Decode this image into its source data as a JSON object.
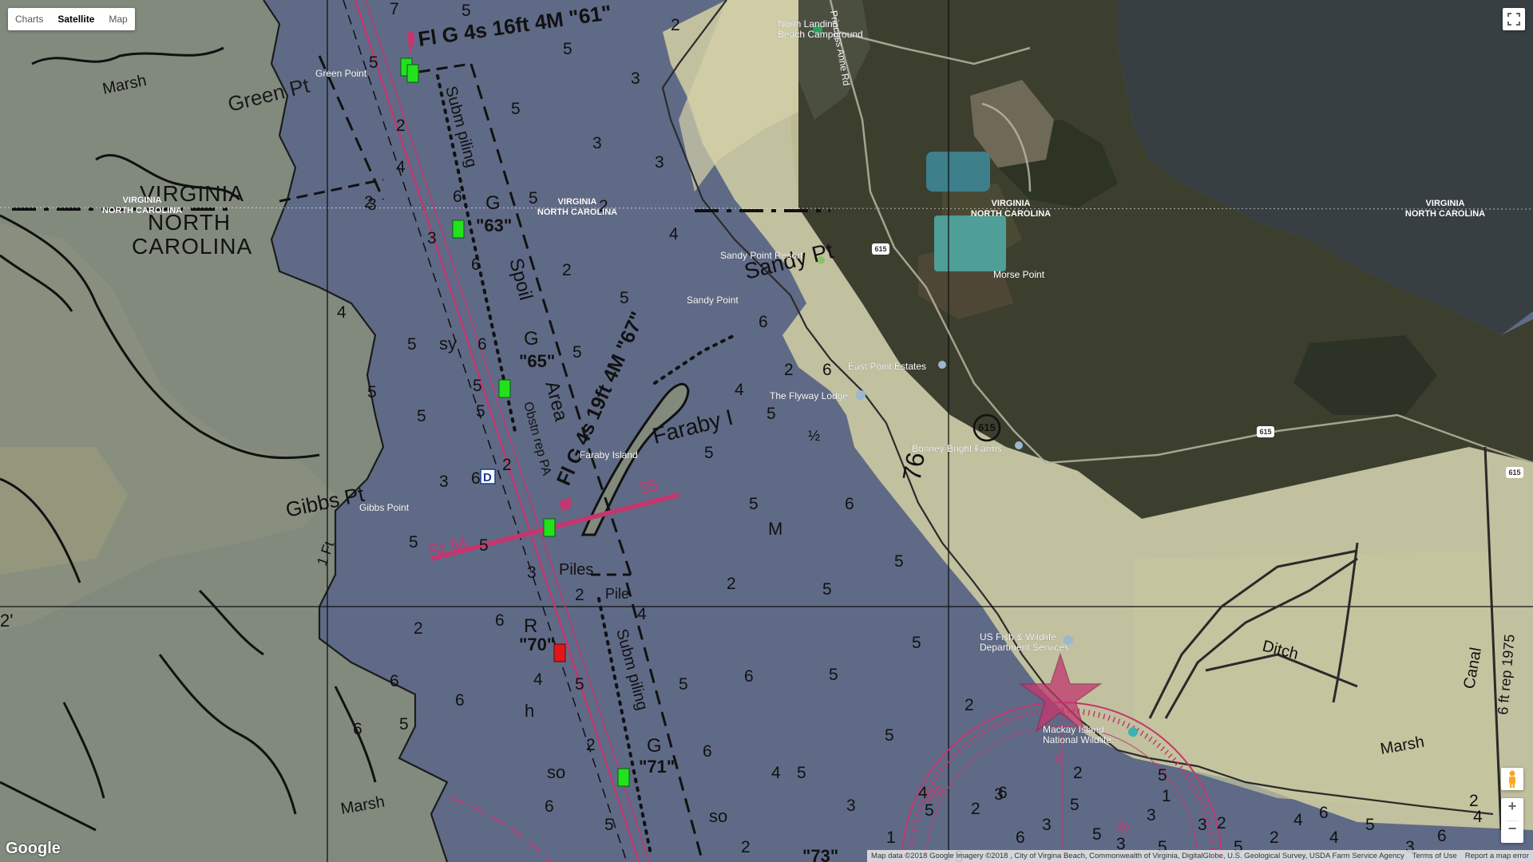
{
  "controls": {
    "map_type_tabs": [
      {
        "label": "Charts",
        "active": false
      },
      {
        "label": "Satellite",
        "active": true
      },
      {
        "label": "Map",
        "active": false
      }
    ],
    "zoom_in": "+",
    "zoom_out": "−",
    "google_logo": "Google"
  },
  "attribution": {
    "map_data": "Map data ©2018 Google Imagery ©2018 , City of Virgina Beach, Commonwealth of Virginia, DigitalGlobe, U.S. Geological Survey, USDA Farm Service Agency",
    "terms": "Terms of Use",
    "report": "Report a map error"
  },
  "chart_labels": {
    "light_61": "Fl G 4s 16ft 4M \"61\"",
    "light_67": "Fl G 4s 19ft 4M \"67\"",
    "green_pt": "Green Pt",
    "marsh_top": "Marsh",
    "virginia": "VIRGINIA",
    "north_carolina": "NORTH CAROLINA",
    "north": "NORTH",
    "carolina": "CAROLINA",
    "subm_piling_1": "Subm piling",
    "subm_piling_2": "Subm piling",
    "spoil": "Spoil",
    "area": "Area",
    "obstn_rep_pa": "Obstn rep PA",
    "g63_g": "G",
    "g63": "\"63\"",
    "g65_g": "G",
    "g65": "\"65\"",
    "g71_g": "G",
    "g71": "\"71\"",
    "r70_r": "R",
    "r70": "\"70\"",
    "sy": "sy",
    "so1": "so",
    "so2": "so",
    "h": "h",
    "m": "M",
    "faraby": "Faraby I",
    "sandy_pt": "Sandy Pt",
    "gibbs_pt": "Gibbs Pt",
    "st_m": "St M",
    "n35": "35",
    "piles": "Piles",
    "pile": "Pile",
    "ift": "1 Ft",
    "ditch": "Ditch",
    "canal": "Canal",
    "marsh_bottom": "Marsh",
    "marsh_lower_left": "Marsh",
    "rep_1975": "6 ft rep 1975",
    "n76": "76",
    "mark_2": "2'",
    "d_marker": "D",
    "g73": "\"73\"",
    "half": "½",
    "compass_0": "0",
    "compass_30": "30",
    "compass_330": "330"
  },
  "soundings": [
    "7",
    "5",
    "2",
    "5",
    "5",
    "3",
    "2",
    "5",
    "4",
    "3",
    "3",
    "2",
    "6",
    "5",
    "2",
    "3",
    "3",
    "6",
    "4",
    "2",
    "5",
    "4",
    "5",
    "6",
    "5",
    "6",
    "5",
    "5",
    "4",
    "2",
    "5",
    "6",
    "5",
    "6",
    "2",
    "5",
    "3",
    "5",
    "5",
    "6",
    "5",
    "5",
    "3",
    "2",
    "5",
    "2",
    "5",
    "4",
    "6",
    "2",
    "5",
    "6",
    "5",
    "4",
    "6",
    "5",
    "5",
    "6",
    "2",
    "5",
    "6",
    "5",
    "2",
    "6",
    "4",
    "5",
    "6",
    "5",
    "2",
    "5",
    "3",
    "2",
    "5",
    "6",
    "3",
    "2",
    "6",
    "4",
    "3",
    "4",
    "5",
    "5",
    "5",
    "6",
    "3",
    "1",
    "2",
    "3",
    "3",
    "4",
    "3",
    "2",
    "5",
    "6",
    "5",
    "2",
    "4",
    "3",
    "1",
    "2"
  ],
  "place_labels": {
    "north_landing": "North Landing\nBeach Campground",
    "princess_anne": "Princess Anne Rd",
    "green_point": "Green Point",
    "virginia_nc_1": "VIRGINIA\nNORTH CAROLINA",
    "virginia_nc_2": "VIRGINIA\nNORTH CAROLINA",
    "virginia_nc_3": "VIRGINIA\nNORTH CAROLINA",
    "virginia_nc_4": "VIRGINIA\nNORTH CAROLINA",
    "sandy_point_resort": "Sandy Point Resort",
    "sandy_point": "Sandy Point",
    "morse_point": "Morse Point",
    "east_point_estates": "East Point Estates",
    "flyway_lodge": "The Flyway Lodge",
    "faraby_island": "Faraby Island",
    "bonney_bright": "Bonney Bright Farms",
    "gibbs_point": "Gibbs Point",
    "usfws": "US Fish & Wildlife\nDepartment Services",
    "mackay": "Mackay Island\nNational Wildlife...",
    "route_615a": "615",
    "route_615b": "615",
    "route_615c": "615",
    "route_615d": "615"
  },
  "colors": {
    "water": "#5f6a86",
    "land_chart": "#828a7e",
    "satellite_dark": "#3b3d2e",
    "overlay_land": "#cfcca3",
    "magenta": "#c2386e",
    "green_buoy": "#21e21c",
    "red_buoy": "#e0161b"
  }
}
